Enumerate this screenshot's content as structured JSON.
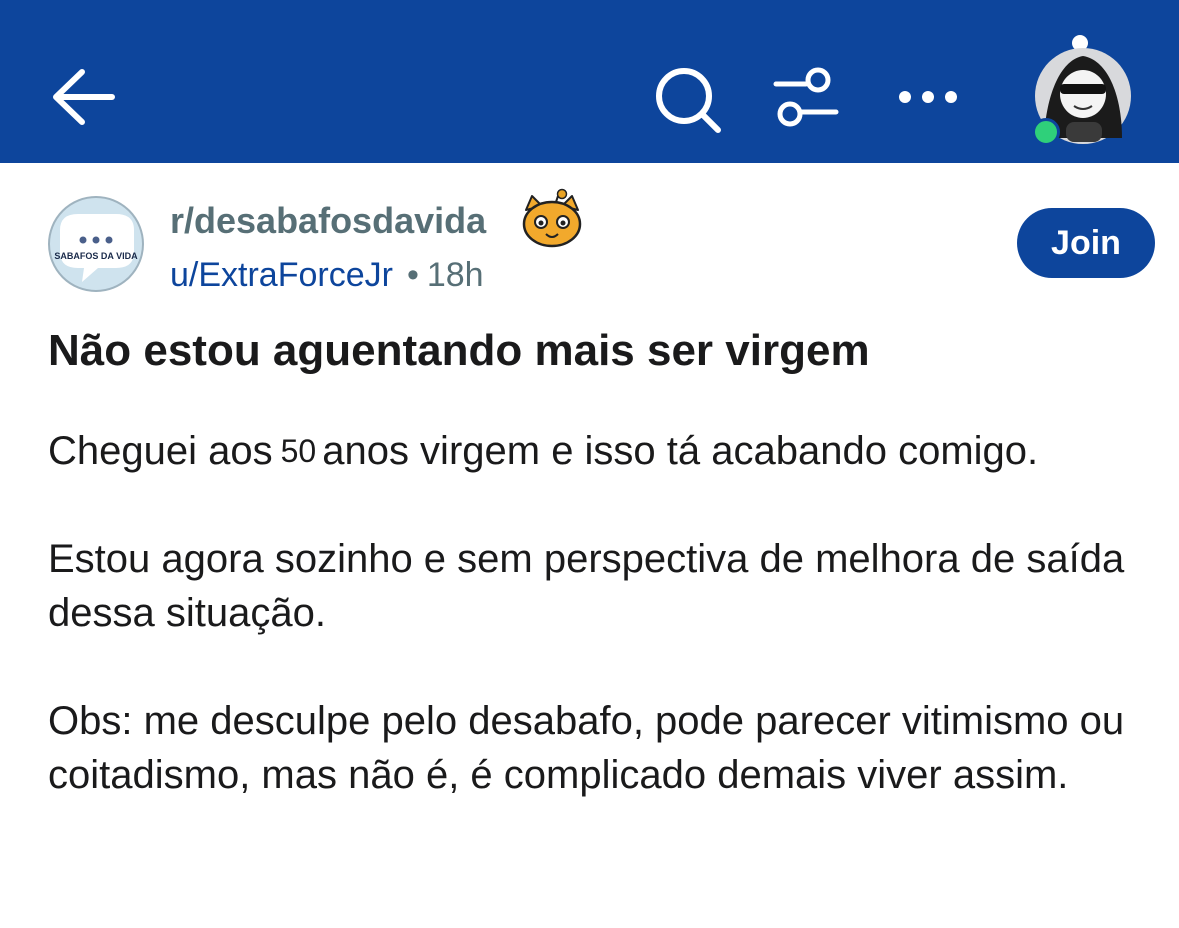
{
  "header": {
    "icons": [
      "back-arrow-icon",
      "search-icon",
      "filter-icon",
      "more-options-icon",
      "user-avatar"
    ],
    "online_indicator_color": "#2fd07a"
  },
  "post": {
    "subreddit": "r/desabafosdavida",
    "subreddit_avatar_text": "SABAFOS DA VIDA",
    "author": "u/ExtraForceJr",
    "separator": "•",
    "time_ago": "18h",
    "join_label": "Join",
    "title": "Não estou aguentando mais ser virgem",
    "body": {
      "p1_before": "Cheguei aos",
      "p1_age": "50",
      "p1_after": "anos virgem e isso tá acabando comigo.",
      "p2": "Estou agora sozinho e sem perspectiva de melhora de saída dessa situação.",
      "p3": "Obs: me desculpe pelo desabafo, pode parecer vitimismo ou coitadismo, mas não é, é complicado demais viver assim."
    }
  },
  "colors": {
    "header_bg": "#0d459c",
    "accent": "#0d459c",
    "meta_gray": "#576f76",
    "text": "#1a1a1b"
  }
}
